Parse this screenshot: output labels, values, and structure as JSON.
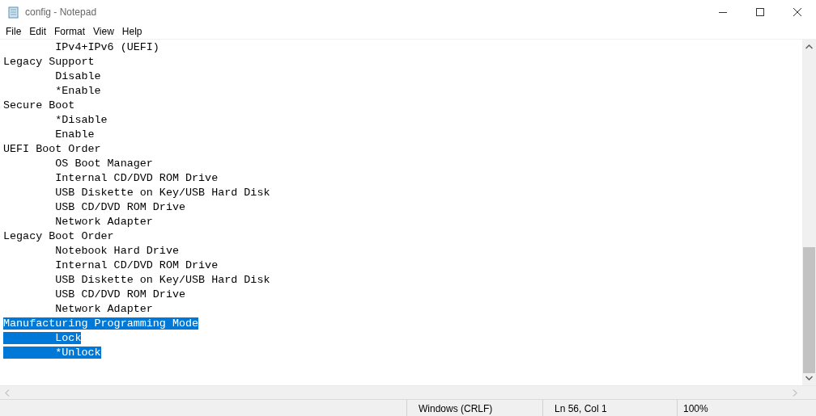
{
  "window": {
    "title": "config - Notepad"
  },
  "menu": [
    "File",
    "Edit",
    "Format",
    "View",
    "Help"
  ],
  "lines": [
    {
      "text": "\tIPv4+IPv6 (UEFI)",
      "selected": false
    },
    {
      "text": "Legacy Support",
      "selected": false
    },
    {
      "text": "\tDisable",
      "selected": false
    },
    {
      "text": "\t*Enable",
      "selected": false
    },
    {
      "text": "Secure Boot",
      "selected": false
    },
    {
      "text": "\t*Disable",
      "selected": false
    },
    {
      "text": "\tEnable",
      "selected": false
    },
    {
      "text": "UEFI Boot Order",
      "selected": false
    },
    {
      "text": "\tOS Boot Manager",
      "selected": false
    },
    {
      "text": "\tInternal CD/DVD ROM Drive",
      "selected": false
    },
    {
      "text": "\tUSB Diskette on Key/USB Hard Disk",
      "selected": false
    },
    {
      "text": "\tUSB CD/DVD ROM Drive",
      "selected": false
    },
    {
      "text": "\tNetwork Adapter",
      "selected": false
    },
    {
      "text": "Legacy Boot Order",
      "selected": false
    },
    {
      "text": "\tNotebook Hard Drive",
      "selected": false
    },
    {
      "text": "\tInternal CD/DVD ROM Drive",
      "selected": false
    },
    {
      "text": "\tUSB Diskette on Key/USB Hard Disk",
      "selected": false
    },
    {
      "text": "\tUSB CD/DVD ROM Drive",
      "selected": false
    },
    {
      "text": "\tNetwork Adapter",
      "selected": false
    },
    {
      "text": "Manufacturing Programming Mode",
      "selected": true
    },
    {
      "text": "\tLock",
      "selected": true
    },
    {
      "text": "\t*Unlock",
      "selected": true
    }
  ],
  "status_bar": {
    "line_ending": "Windows (CRLF)",
    "position": "Ln 56, Col 1",
    "zoom": "100%"
  }
}
